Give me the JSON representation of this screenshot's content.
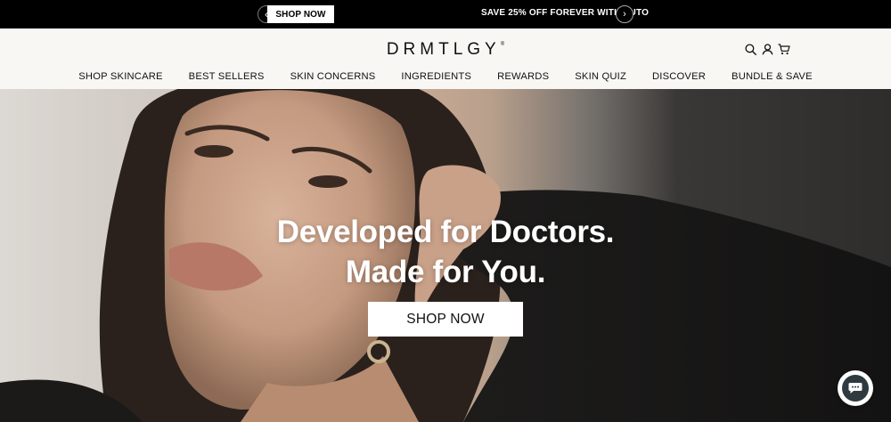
{
  "announcement": {
    "prev_glyph": "‹",
    "shop_label": "SHOP NOW",
    "message": "SAVE 25% OFF FOREVER WITH AUTO",
    "next_glyph": "›"
  },
  "header": {
    "logo": "DRMTLGY",
    "logo_mark": "®",
    "icons": [
      "search-icon",
      "account-icon",
      "cart-icon"
    ]
  },
  "nav": {
    "items": [
      {
        "label": "SHOP SKINCARE"
      },
      {
        "label": "BEST SELLERS"
      },
      {
        "label": "SKIN CONCERNS"
      },
      {
        "label": "INGREDIENTS"
      },
      {
        "label": "REWARDS"
      },
      {
        "label": "SKIN QUIZ"
      },
      {
        "label": "DISCOVER"
      },
      {
        "label": "BUNDLE & SAVE"
      }
    ]
  },
  "hero": {
    "headline_1": "Developed for Doctors.",
    "headline_2": "Made for You.",
    "cta": "SHOP NOW"
  },
  "chat": {
    "icon": "chat-bubble-icon"
  },
  "colors": {
    "announcement_bg": "#000000",
    "header_bg": "#f8f7f4",
    "chat_bg": "#2e3a3f"
  }
}
